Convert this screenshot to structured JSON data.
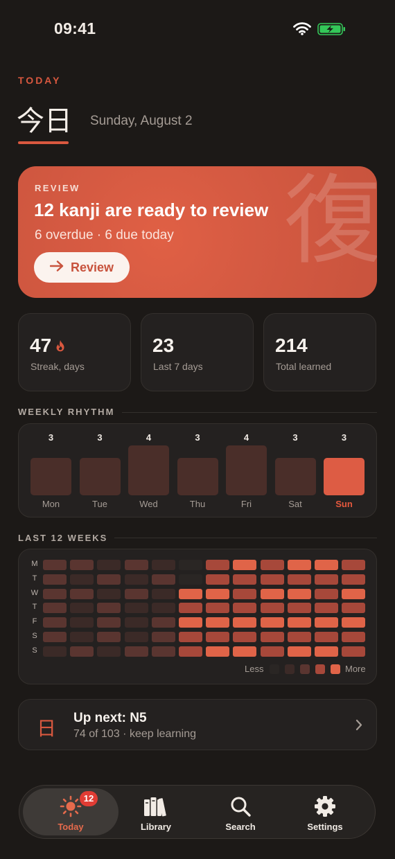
{
  "status_bar": {
    "time": "09:41",
    "wifi_icon": "wifi-icon",
    "battery_icon": "battery-charging-icon",
    "battery_color": "#34c759"
  },
  "header": {
    "eyebrow": "TODAY",
    "title": "今日",
    "date": "Sunday, August 2"
  },
  "review": {
    "label": "REVIEW",
    "title": "12 kanji are ready to review",
    "subtitle": "6 overdue · 6 due today",
    "button_label": "Review",
    "watermark": "復",
    "accent_color": "#d55a42"
  },
  "stats": [
    {
      "value": "47",
      "label": "Streak, days",
      "icon": "flame-icon"
    },
    {
      "value": "23",
      "label": "Last 7 days"
    },
    {
      "value": "214",
      "label": "Total learned"
    }
  ],
  "weekly_rhythm": {
    "title": "WEEKLY RHYTHM",
    "days": [
      {
        "day": "Mon",
        "count": 3
      },
      {
        "day": "Tue",
        "count": 3
      },
      {
        "day": "Wed",
        "count": 4
      },
      {
        "day": "Thu",
        "count": 3
      },
      {
        "day": "Fri",
        "count": 4
      },
      {
        "day": "Sat",
        "count": 3
      },
      {
        "day": "Sun",
        "count": 3,
        "today": true
      }
    ]
  },
  "heatmap": {
    "title": "LAST 12 WEEKS",
    "row_labels": [
      "M",
      "T",
      "W",
      "T",
      "F",
      "S",
      "S"
    ],
    "levels": [
      [
        2,
        2,
        1,
        2,
        1,
        0,
        3,
        4,
        3,
        4,
        4,
        3
      ],
      [
        2,
        1,
        2,
        1,
        2,
        0,
        3,
        3,
        3,
        3,
        3,
        3
      ],
      [
        2,
        2,
        1,
        2,
        1,
        4,
        4,
        3,
        4,
        4,
        3,
        4
      ],
      [
        2,
        1,
        2,
        1,
        1,
        3,
        3,
        3,
        3,
        3,
        3,
        3
      ],
      [
        2,
        1,
        2,
        1,
        2,
        4,
        4,
        4,
        4,
        4,
        4,
        4
      ],
      [
        2,
        1,
        2,
        1,
        2,
        3,
        3,
        3,
        3,
        3,
        3,
        3
      ],
      [
        1,
        2,
        1,
        2,
        2,
        3,
        4,
        4,
        3,
        4,
        4,
        3
      ]
    ],
    "palette": [
      "#2a2624",
      "#3b2a27",
      "#5a3530",
      "#a7483a",
      "#e06448"
    ],
    "legend_less": "Less",
    "legend_more": "More"
  },
  "up_next": {
    "kanji": "日",
    "title": "Up next: N5",
    "subtitle": "74 of 103 · keep learning",
    "chevron_icon": "chevron-right-icon"
  },
  "tabbar": {
    "tabs": [
      {
        "label": "Today",
        "icon": "sun-icon",
        "active": true,
        "badge": "12"
      },
      {
        "label": "Library",
        "icon": "books-icon"
      },
      {
        "label": "Search",
        "icon": "search-icon"
      },
      {
        "label": "Settings",
        "icon": "gear-icon"
      }
    ]
  }
}
